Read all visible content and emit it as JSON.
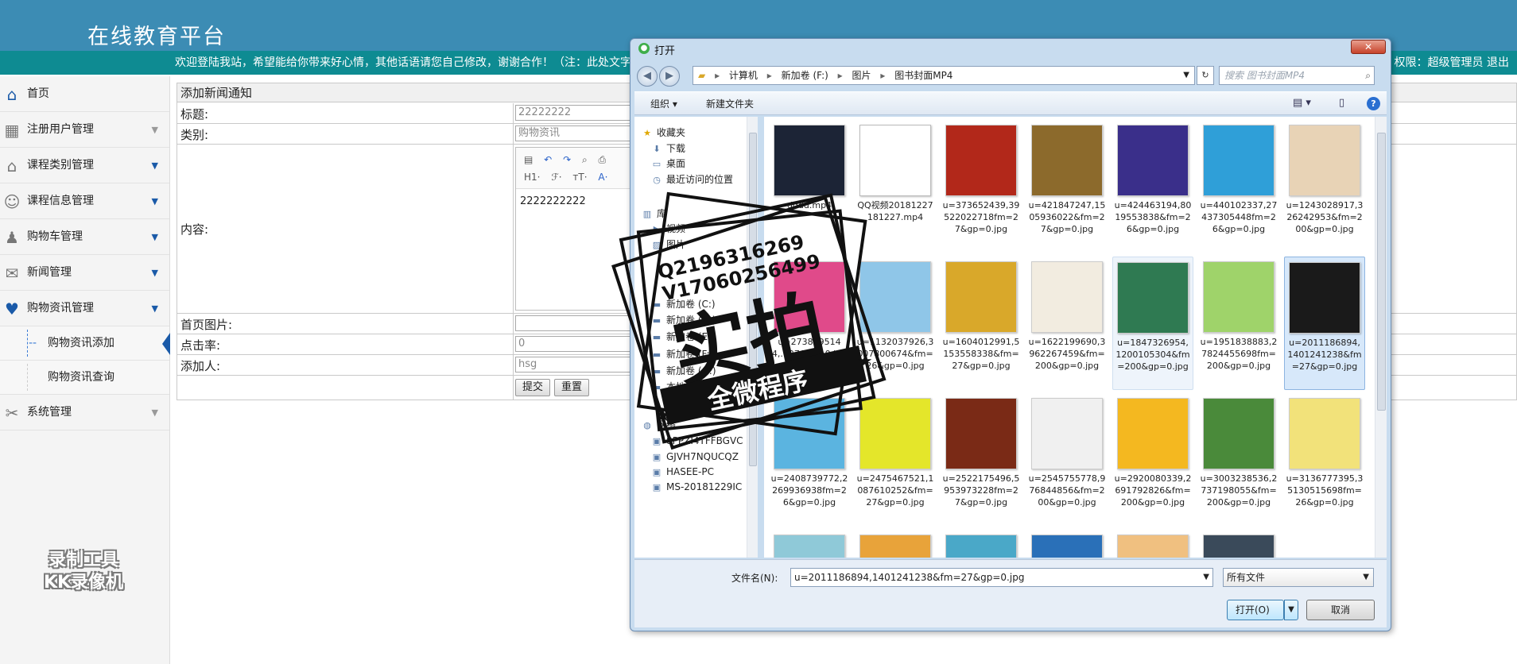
{
  "app": {
    "title": "在线教育平台",
    "welcome": "欢迎登陆我站，希望能给你带来好心情，其他话语请您自己修改，谢谢合作！（注：此处文字",
    "permission": "权限：超级管理员  退出"
  },
  "sidebar": {
    "items": [
      {
        "label": "首页",
        "icon": "home-icon"
      },
      {
        "label": "注册用户管理",
        "icon": "grid-icon"
      },
      {
        "label": "课程类别管理",
        "icon": "house-icon"
      },
      {
        "label": "课程信息管理",
        "icon": "users-icon"
      },
      {
        "label": "购物车管理",
        "icon": "person-icon"
      },
      {
        "label": "新闻管理",
        "icon": "chat-icon"
      },
      {
        "label": "购物资讯管理",
        "icon": "heart-icon"
      }
    ],
    "sub_items": [
      {
        "label": "购物资讯添加",
        "active": true
      },
      {
        "label": "购物资讯查询",
        "active": false
      }
    ],
    "system": {
      "label": "系统管理",
      "icon": "tools-icon"
    }
  },
  "watermark_kk": {
    "line1": "录制工具",
    "line2": "KK录像机"
  },
  "form": {
    "heading": "添加新闻通知",
    "title_label": "标题:",
    "title_value": "22222222",
    "category_label": "类别:",
    "category_value": "购物资讯",
    "content_label": "内容:",
    "content_value": "2222222222",
    "image_label": "首页图片:",
    "clicks_label": "点击率:",
    "clicks_value": "0",
    "author_label": "添加人:",
    "author_value": "hsg",
    "submit": "提交",
    "reset": "重置",
    "toolbar_row2": [
      "H1·",
      "ℱ·",
      "тT·",
      "A·"
    ]
  },
  "dialog": {
    "title": "打开",
    "close": "✕",
    "address": [
      "计算机",
      "新加卷 (F:)",
      "图片",
      "图书封面MP4"
    ],
    "search_placeholder": "搜索 图书封面MP4",
    "organize": "组织 ▾",
    "new_folder": "新建文件夹",
    "tree": [
      {
        "label": "收藏夹",
        "icon": "star-icon"
      },
      {
        "label": "下载",
        "icon": "download-icon"
      },
      {
        "label": "桌面",
        "icon": "desktop-icon"
      },
      {
        "label": "最近访问的位置",
        "icon": "recent-icon"
      },
      {
        "label": "库",
        "icon": "library-icon"
      },
      {
        "label": "视频",
        "icon": "video-icon"
      },
      {
        "label": "图片",
        "icon": "picture-icon"
      },
      {
        "label": "新加卷 (C:)",
        "icon": "drive-icon"
      },
      {
        "label": "新加卷 (D:)",
        "icon": "drive-icon"
      },
      {
        "label": "新加卷 (E:)",
        "icon": "drive-icon"
      },
      {
        "label": "新加卷 (F:)",
        "icon": "drive-icon"
      },
      {
        "label": "新加卷 (G:)",
        "icon": "drive-icon"
      },
      {
        "label": "本地磁盘 (H:)",
        "icon": "drive-icon"
      },
      {
        "label": "网络",
        "icon": "network-icon"
      },
      {
        "label": "8PPZI4TFFBGVC",
        "icon": "computer-icon"
      },
      {
        "label": "GJVH7NQUCQZ",
        "icon": "computer-icon"
      },
      {
        "label": "HASEE-PC",
        "icon": "computer-icon"
      },
      {
        "label": "MS-20181229IC",
        "icon": "computer-icon"
      }
    ],
    "files": [
      {
        "name": "dddd.mp4",
        "color": "#1c2436"
      },
      {
        "name": "QQ视频20181227181227.mp4",
        "color": "#e9eef5"
      },
      {
        "name": "u=373652439,39522022718fm=27&gp=0.jpg",
        "color": "#b2281a"
      },
      {
        "name": "u=421847247,1505936022&fm=27&gp=0.jpg",
        "color": "#8c6a2c"
      },
      {
        "name": "u=424463194,8019553838&fm=26&gp=0.jpg",
        "color": "#3a2f8a"
      },
      {
        "name": "u=440102337,27437305448fm=26&gp=0.jpg",
        "color": "#2f9fd8"
      },
      {
        "name": "u=1243028917,326242953&fm=200&gp=0.jpg",
        "color": "#e8d3b6"
      },
      {
        "name": "u=2738295144,...27&gp=0.jpg",
        "color": "#e04a8a"
      },
      {
        "name": "u=1132037926,3007800674&fm=26&gp=0.jpg",
        "color": "#8fc6e8"
      },
      {
        "name": "u=1604012991,5153558338&fm=27&gp=0.jpg",
        "color": "#d9a82a"
      },
      {
        "name": "u=1622199690,3962267459&fm=200&gp=0.jpg",
        "color": "#f2ece0"
      },
      {
        "name": "u=1847326954,1200105304&fm=200&gp=0.jpg",
        "color": "#2f7a52"
      },
      {
        "name": "u=1951838883,27824455698fm=200&gp=0.jpg",
        "color": "#9fd36a"
      },
      {
        "name": "u=2011186894,1401241238&fm=27&gp=0.jpg",
        "color": "#1a1a1a"
      },
      {
        "name": "u=2408739772,2269936938fm=26&gp=0.jpg",
        "color": "#5bb4e0"
      },
      {
        "name": "u=2475467521,1087610252&fm=27&gp=0.jpg",
        "color": "#e4e62a"
      },
      {
        "name": "u=2522175496,5953973228fm=27&gp=0.jpg",
        "color": "#7a2a16"
      },
      {
        "name": "u=2545755778,976844856&fm=200&gp=0.jpg",
        "color": "#f0f0f0"
      },
      {
        "name": "u=2920080339,2691792826&fm=200&gp=0.jpg",
        "color": "#f4b820"
      },
      {
        "name": "u=3003238536,2737198055&fm=200&gp=0.jpg",
        "color": "#4a8a3a"
      },
      {
        "name": "u=3136777395,35130515698fm=26&gp=0.jpg",
        "color": "#f2e27a"
      },
      {
        "name": "",
        "color": "#8fc9d8"
      },
      {
        "name": "",
        "color": "#e8a33a"
      },
      {
        "name": "",
        "color": "#4aa8c8"
      },
      {
        "name": "",
        "color": "#2a70b8"
      },
      {
        "name": "",
        "color": "#f0c080"
      },
      {
        "name": "",
        "color": "#3a4a5a"
      }
    ],
    "selected_index": 13,
    "filename_label": "文件名(N):",
    "filename_value": "u=2011186894,1401241238&fm=27&gp=0.jpg",
    "filetype": "所有文件",
    "open": "打开(O)",
    "cancel": "取消"
  },
  "stamp": {
    "qq": "Q2196316269",
    "vx": "V17060256499",
    "big": "实拍",
    "banner": "全微程序"
  }
}
